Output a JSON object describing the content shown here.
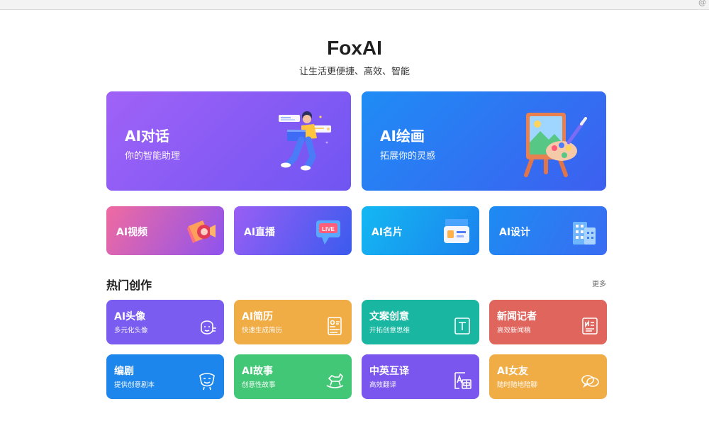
{
  "browser": {
    "corner_text": "@"
  },
  "brand": {
    "title": "FoxAI",
    "slogan": "让生活更便捷、高效、智能"
  },
  "hero_cards": [
    {
      "title": "AI对话",
      "subtitle": "你的智能助理",
      "illustration": "person-chat-illustration",
      "colors": [
        "#a062f7",
        "#7055f2"
      ]
    },
    {
      "title": "AI绘画",
      "subtitle": "拓展你的灵感",
      "illustration": "easel-palette-illustration",
      "colors": [
        "#1f8cf5",
        "#3d5ff0"
      ]
    }
  ],
  "mid_cards": [
    {
      "title": "AI视频",
      "icon": "video-camera-icon",
      "colors": [
        "#f06aa0",
        "#8e53ef"
      ]
    },
    {
      "title": "AI直播",
      "icon": "live-tv-icon",
      "colors": [
        "#9a5ef5",
        "#3a5bee"
      ]
    },
    {
      "title": "AI名片",
      "icon": "business-card-icon",
      "colors": [
        "#13b8f2",
        "#1c82ee"
      ]
    },
    {
      "title": "AI设计",
      "icon": "building-icon",
      "colors": [
        "#1d8bf2",
        "#3a6cf2"
      ]
    }
  ],
  "section": {
    "title": "热门创作",
    "more_label": "更多"
  },
  "creation_tiles": [
    {
      "title": "AI头像",
      "subtitle": "多元化头像",
      "icon": "avatar-face-icon",
      "color": "#7a5df0"
    },
    {
      "title": "AI简历",
      "subtitle": "快速生成简历",
      "icon": "resume-document-icon",
      "color": "#f0ac45"
    },
    {
      "title": "文案创意",
      "subtitle": "开拓创意思维",
      "icon": "text-t-icon",
      "color": "#19b7a2"
    },
    {
      "title": "新闻记者",
      "subtitle": "高效新闻稿",
      "icon": "newspaper-icon",
      "color": "#e0665d"
    },
    {
      "title": "编剧",
      "subtitle": "提供创意剧本",
      "icon": "theater-mask-icon",
      "color": "#1c86ec"
    },
    {
      "title": "AI故事",
      "subtitle": "创意性故事",
      "icon": "rocking-horse-icon",
      "color": "#42c777"
    },
    {
      "title": "中英互译",
      "subtitle": "高效翻译",
      "icon": "translate-icon",
      "color": "#7a56ef"
    },
    {
      "title": "AI女友",
      "subtitle": "随时随地陪聊",
      "icon": "chat-bubbles-icon",
      "color": "#f0ac45"
    }
  ]
}
